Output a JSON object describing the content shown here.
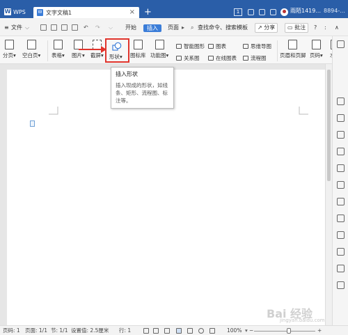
{
  "titlebar": {
    "app": "WPS",
    "doc_tab": "文字文稿1",
    "doc_icon": "W",
    "badge": "1",
    "user": "雨陌1419...",
    "user_id": "8894-..."
  },
  "menubar": {
    "file": "文件",
    "tabs": [
      "开始",
      "插入",
      "页面"
    ],
    "active_tab": "插入",
    "search": "查找命令、搜索模板",
    "share": "分享",
    "comment": "批注",
    "help": "?"
  },
  "ribbon": {
    "page_break": "分页",
    "blank_page": "空白页",
    "table": "表格",
    "picture": "图片",
    "screenshot": "截屏",
    "shape": "形状",
    "icon_lib": "图标库",
    "function_chart": "功能图",
    "smart_art": "智能图形",
    "chart": "图表",
    "mind_map": "思维导图",
    "relation": "关系图",
    "online_chart": "在线图表",
    "flow_chart": "流程图",
    "header_footer": "页眉和页脚",
    "page_number": "页码",
    "watermark": "水印"
  },
  "tooltip": {
    "title": "插入形状",
    "body": "插入现成的形状，如线条、矩形、流程图、标注等。"
  },
  "statusbar": {
    "page_num": "页码: 1",
    "pages": "页面: 1/1",
    "section": "节: 1/1",
    "setting": "设置值: 2.5厘米",
    "row": "行: 1",
    "zoom": "100%"
  },
  "watermark": {
    "text": "Bai 经验",
    "sub": "jingyan.baidu.com"
  },
  "colors": {
    "titlebar": "#2a5ea8",
    "accent": "#3b7dd8",
    "highlight": "#e0342c"
  }
}
